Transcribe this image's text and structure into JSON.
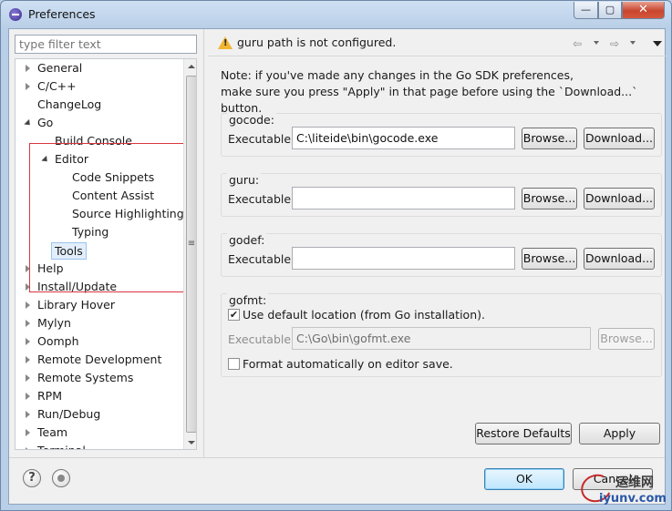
{
  "window": {
    "title": "Preferences",
    "min_glyph": "—",
    "max_glyph": "▢",
    "close_glyph": "✕"
  },
  "filter": {
    "placeholder": "type filter text"
  },
  "tree": {
    "items": [
      {
        "label": "General",
        "twisty": "closed",
        "indent": 0
      },
      {
        "label": "C/C++",
        "twisty": "closed",
        "indent": 0
      },
      {
        "label": "ChangeLog",
        "twisty": "none",
        "indent": 0
      },
      {
        "label": "Go",
        "twisty": "open",
        "indent": 0
      },
      {
        "label": "Build Console",
        "twisty": "none",
        "indent": 1
      },
      {
        "label": "Editor",
        "twisty": "open",
        "indent": 1
      },
      {
        "label": "Code Snippets",
        "twisty": "none",
        "indent": 2
      },
      {
        "label": "Content Assist",
        "twisty": "none",
        "indent": 2
      },
      {
        "label": "Source Highlighting",
        "twisty": "none",
        "indent": 2
      },
      {
        "label": "Typing",
        "twisty": "none",
        "indent": 2
      },
      {
        "label": "Tools",
        "twisty": "none",
        "indent": 1,
        "selected": true
      },
      {
        "label": "Help",
        "twisty": "closed",
        "indent": 0
      },
      {
        "label": "Install/Update",
        "twisty": "closed",
        "indent": 0
      },
      {
        "label": "Library Hover",
        "twisty": "closed",
        "indent": 0
      },
      {
        "label": "Mylyn",
        "twisty": "closed",
        "indent": 0
      },
      {
        "label": "Oomph",
        "twisty": "closed",
        "indent": 0
      },
      {
        "label": "Remote Development",
        "twisty": "closed",
        "indent": 0
      },
      {
        "label": "Remote Systems",
        "twisty": "closed",
        "indent": 0
      },
      {
        "label": "RPM",
        "twisty": "closed",
        "indent": 0
      },
      {
        "label": "Run/Debug",
        "twisty": "closed",
        "indent": 0
      },
      {
        "label": "Team",
        "twisty": "closed",
        "indent": 0
      },
      {
        "label": "Terminal",
        "twisty": "closed",
        "indent": 0
      }
    ]
  },
  "header": {
    "message": "guru path is not configured.",
    "back_glyph": "⇦",
    "forward_glyph": "⇨"
  },
  "note": {
    "line1": "Note: if you've made any changes in the Go SDK preferences,",
    "line2": "make sure you press \"Apply\" in that page before using the `Download...` button."
  },
  "groups": {
    "gocode": {
      "title": "gocode:",
      "exe_label": "Executable:",
      "value": "C:\\liteide\\bin\\gocode.exe",
      "browse": "Browse...",
      "download": "Download..."
    },
    "guru": {
      "title": "guru:",
      "exe_label": "Executable:",
      "value": "",
      "browse": "Browse...",
      "download": "Download..."
    },
    "godef": {
      "title": "godef:",
      "exe_label": "Executable:",
      "value": "",
      "browse": "Browse...",
      "download": "Download..."
    },
    "gofmt": {
      "title": "gofmt:",
      "use_default_label": "Use default location (from Go installation).",
      "use_default_checked": true,
      "exe_label": "Executable:",
      "value": "C:\\Go\\bin\\gofmt.exe",
      "browse": "Browse...",
      "format_auto_label": "Format automatically on editor save.",
      "format_auto_checked": false
    }
  },
  "buttons": {
    "restore_defaults": "Restore Defaults",
    "apply": "Apply",
    "ok": "OK",
    "cancel": "Cancel"
  },
  "footer": {
    "help_glyph": "?"
  },
  "watermark": {
    "text": "运维网",
    "url": "iyunv.com"
  }
}
